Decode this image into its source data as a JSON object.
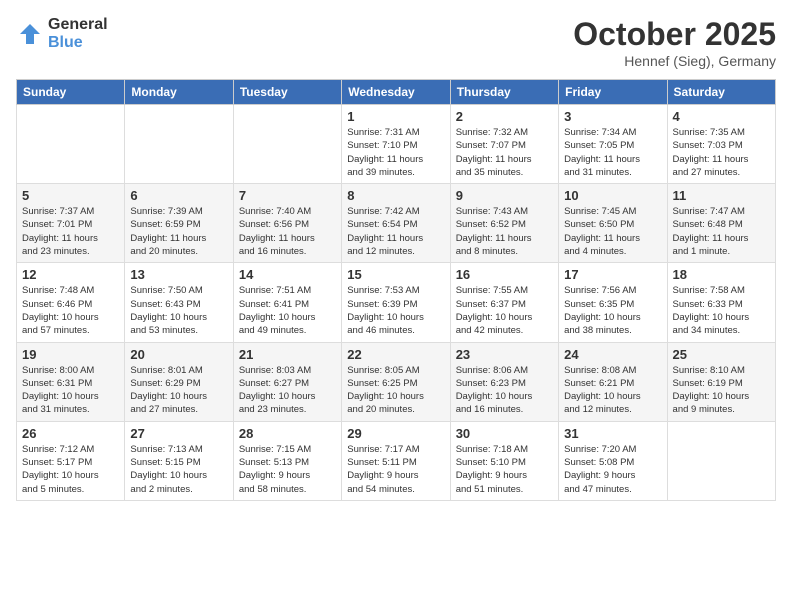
{
  "header": {
    "logo_general": "General",
    "logo_blue": "Blue",
    "month_title": "October 2025",
    "location": "Hennef (Sieg), Germany"
  },
  "weekdays": [
    "Sunday",
    "Monday",
    "Tuesday",
    "Wednesday",
    "Thursday",
    "Friday",
    "Saturday"
  ],
  "weeks": [
    [
      {
        "day": "",
        "info": ""
      },
      {
        "day": "",
        "info": ""
      },
      {
        "day": "",
        "info": ""
      },
      {
        "day": "1",
        "info": "Sunrise: 7:31 AM\nSunset: 7:10 PM\nDaylight: 11 hours\nand 39 minutes."
      },
      {
        "day": "2",
        "info": "Sunrise: 7:32 AM\nSunset: 7:07 PM\nDaylight: 11 hours\nand 35 minutes."
      },
      {
        "day": "3",
        "info": "Sunrise: 7:34 AM\nSunset: 7:05 PM\nDaylight: 11 hours\nand 31 minutes."
      },
      {
        "day": "4",
        "info": "Sunrise: 7:35 AM\nSunset: 7:03 PM\nDaylight: 11 hours\nand 27 minutes."
      }
    ],
    [
      {
        "day": "5",
        "info": "Sunrise: 7:37 AM\nSunset: 7:01 PM\nDaylight: 11 hours\nand 23 minutes."
      },
      {
        "day": "6",
        "info": "Sunrise: 7:39 AM\nSunset: 6:59 PM\nDaylight: 11 hours\nand 20 minutes."
      },
      {
        "day": "7",
        "info": "Sunrise: 7:40 AM\nSunset: 6:56 PM\nDaylight: 11 hours\nand 16 minutes."
      },
      {
        "day": "8",
        "info": "Sunrise: 7:42 AM\nSunset: 6:54 PM\nDaylight: 11 hours\nand 12 minutes."
      },
      {
        "day": "9",
        "info": "Sunrise: 7:43 AM\nSunset: 6:52 PM\nDaylight: 11 hours\nand 8 minutes."
      },
      {
        "day": "10",
        "info": "Sunrise: 7:45 AM\nSunset: 6:50 PM\nDaylight: 11 hours\nand 4 minutes."
      },
      {
        "day": "11",
        "info": "Sunrise: 7:47 AM\nSunset: 6:48 PM\nDaylight: 11 hours\nand 1 minute."
      }
    ],
    [
      {
        "day": "12",
        "info": "Sunrise: 7:48 AM\nSunset: 6:46 PM\nDaylight: 10 hours\nand 57 minutes."
      },
      {
        "day": "13",
        "info": "Sunrise: 7:50 AM\nSunset: 6:43 PM\nDaylight: 10 hours\nand 53 minutes."
      },
      {
        "day": "14",
        "info": "Sunrise: 7:51 AM\nSunset: 6:41 PM\nDaylight: 10 hours\nand 49 minutes."
      },
      {
        "day": "15",
        "info": "Sunrise: 7:53 AM\nSunset: 6:39 PM\nDaylight: 10 hours\nand 46 minutes."
      },
      {
        "day": "16",
        "info": "Sunrise: 7:55 AM\nSunset: 6:37 PM\nDaylight: 10 hours\nand 42 minutes."
      },
      {
        "day": "17",
        "info": "Sunrise: 7:56 AM\nSunset: 6:35 PM\nDaylight: 10 hours\nand 38 minutes."
      },
      {
        "day": "18",
        "info": "Sunrise: 7:58 AM\nSunset: 6:33 PM\nDaylight: 10 hours\nand 34 minutes."
      }
    ],
    [
      {
        "day": "19",
        "info": "Sunrise: 8:00 AM\nSunset: 6:31 PM\nDaylight: 10 hours\nand 31 minutes."
      },
      {
        "day": "20",
        "info": "Sunrise: 8:01 AM\nSunset: 6:29 PM\nDaylight: 10 hours\nand 27 minutes."
      },
      {
        "day": "21",
        "info": "Sunrise: 8:03 AM\nSunset: 6:27 PM\nDaylight: 10 hours\nand 23 minutes."
      },
      {
        "day": "22",
        "info": "Sunrise: 8:05 AM\nSunset: 6:25 PM\nDaylight: 10 hours\nand 20 minutes."
      },
      {
        "day": "23",
        "info": "Sunrise: 8:06 AM\nSunset: 6:23 PM\nDaylight: 10 hours\nand 16 minutes."
      },
      {
        "day": "24",
        "info": "Sunrise: 8:08 AM\nSunset: 6:21 PM\nDaylight: 10 hours\nand 12 minutes."
      },
      {
        "day": "25",
        "info": "Sunrise: 8:10 AM\nSunset: 6:19 PM\nDaylight: 10 hours\nand 9 minutes."
      }
    ],
    [
      {
        "day": "26",
        "info": "Sunrise: 7:12 AM\nSunset: 5:17 PM\nDaylight: 10 hours\nand 5 minutes."
      },
      {
        "day": "27",
        "info": "Sunrise: 7:13 AM\nSunset: 5:15 PM\nDaylight: 10 hours\nand 2 minutes."
      },
      {
        "day": "28",
        "info": "Sunrise: 7:15 AM\nSunset: 5:13 PM\nDaylight: 9 hours\nand 58 minutes."
      },
      {
        "day": "29",
        "info": "Sunrise: 7:17 AM\nSunset: 5:11 PM\nDaylight: 9 hours\nand 54 minutes."
      },
      {
        "day": "30",
        "info": "Sunrise: 7:18 AM\nSunset: 5:10 PM\nDaylight: 9 hours\nand 51 minutes."
      },
      {
        "day": "31",
        "info": "Sunrise: 7:20 AM\nSunset: 5:08 PM\nDaylight: 9 hours\nand 47 minutes."
      },
      {
        "day": "",
        "info": ""
      }
    ]
  ]
}
